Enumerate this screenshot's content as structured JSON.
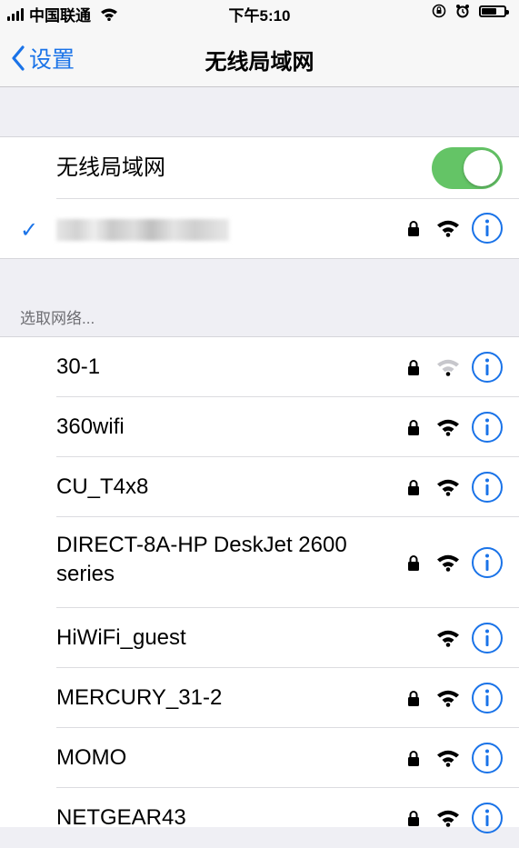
{
  "status_bar": {
    "carrier": "中国联通",
    "time": "下午5:10"
  },
  "nav": {
    "back_label": "设置",
    "title": "无线局域网"
  },
  "wifi_toggle": {
    "label": "无线局域网",
    "on": true,
    "color": "#64c466"
  },
  "connected_network": {
    "name_obscured": true,
    "secured": true,
    "signal": "full"
  },
  "section_header": "选取网络...",
  "networks": [
    {
      "name": "30-1",
      "secured": true,
      "signal": "weak"
    },
    {
      "name": "360wifi",
      "secured": true,
      "signal": "full"
    },
    {
      "name": "CU_T4x8",
      "secured": true,
      "signal": "full"
    },
    {
      "name": "DIRECT-8A-HP DeskJet 2600",
      "name_line2": "series",
      "secured": true,
      "signal": "full"
    },
    {
      "name": "HiWiFi_guest",
      "secured": false,
      "signal": "full"
    },
    {
      "name": "MERCURY_31-2",
      "secured": true,
      "signal": "full"
    },
    {
      "name": "MOMO",
      "secured": true,
      "signal": "full"
    },
    {
      "name": "NETGEAR43",
      "secured": true,
      "signal": "full"
    }
  ],
  "accent_color": "#1a73e8"
}
